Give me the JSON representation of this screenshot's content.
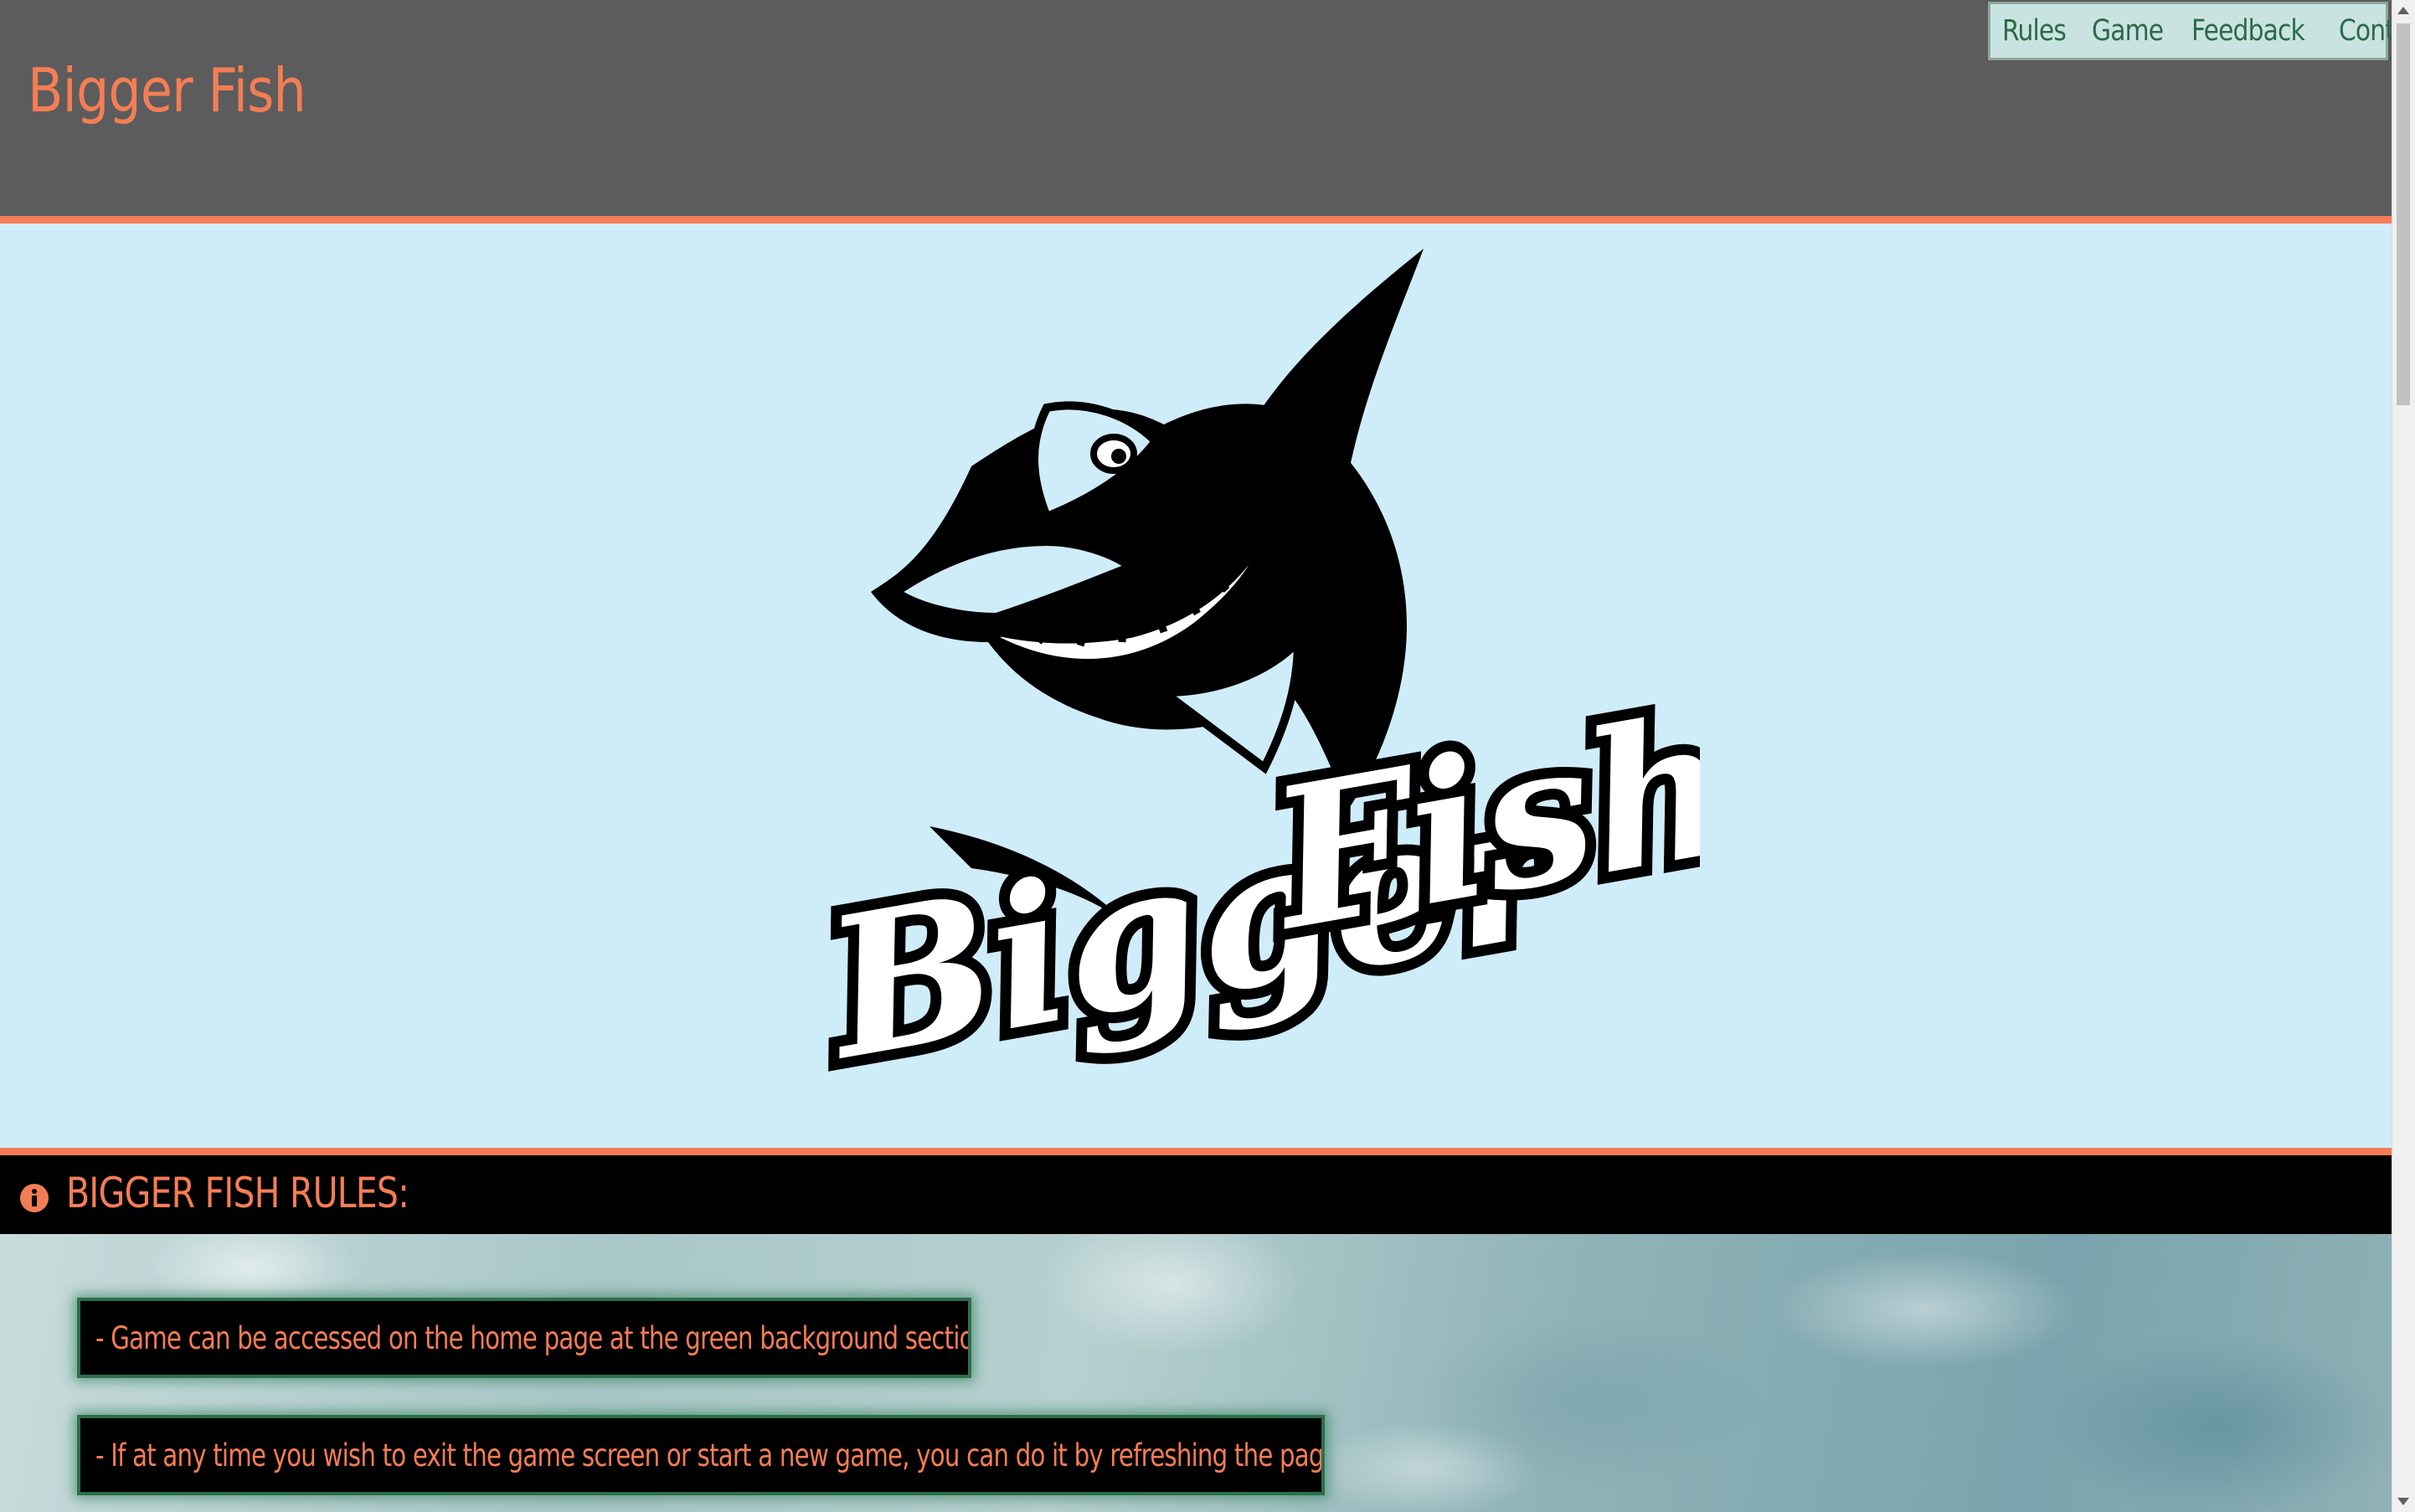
{
  "header": {
    "title": "Bigger Fish"
  },
  "nav": {
    "items": [
      {
        "label": "Rules"
      },
      {
        "label": "Game"
      },
      {
        "label": "Feedback"
      },
      {
        "label": "Contact"
      }
    ]
  },
  "hero": {
    "logo_text": "Bigger Fish",
    "logo_icon": "shark-logo-icon"
  },
  "rules": {
    "icon": "info-circle-icon",
    "title": "BIGGER FISH RULES:",
    "items": [
      "- Game can be accessed on the home page at the green background section",
      "- If at any time you wish to exit the game screen or start a new game, you can do it by refreshing the page"
    ]
  },
  "colors": {
    "accent": "#f47d55",
    "header_bg": "#5c5c5c",
    "hero_bg": "#cfecf9",
    "nav_bg": "#c9e4e0",
    "nav_text": "#2b6a4a",
    "rule_border": "#2e6e4c"
  }
}
